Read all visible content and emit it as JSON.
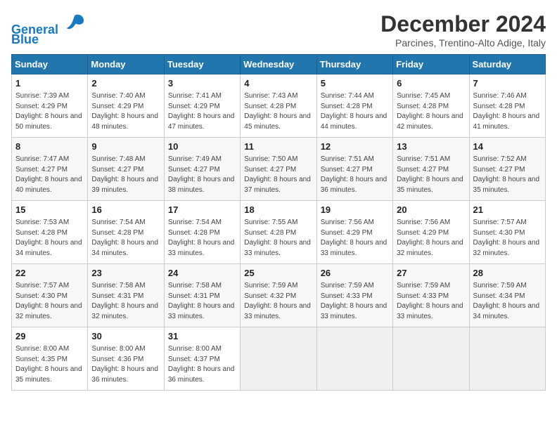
{
  "logo": {
    "line1": "General",
    "line2": "Blue"
  },
  "title": "December 2024",
  "subtitle": "Parcines, Trentino-Alto Adige, Italy",
  "weekdays": [
    "Sunday",
    "Monday",
    "Tuesday",
    "Wednesday",
    "Thursday",
    "Friday",
    "Saturday"
  ],
  "weeks": [
    [
      {
        "day": "1",
        "rise": "7:39 AM",
        "set": "4:29 PM",
        "daylight": "8 hours and 50 minutes."
      },
      {
        "day": "2",
        "rise": "7:40 AM",
        "set": "4:29 PM",
        "daylight": "8 hours and 48 minutes."
      },
      {
        "day": "3",
        "rise": "7:41 AM",
        "set": "4:29 PM",
        "daylight": "8 hours and 47 minutes."
      },
      {
        "day": "4",
        "rise": "7:43 AM",
        "set": "4:28 PM",
        "daylight": "8 hours and 45 minutes."
      },
      {
        "day": "5",
        "rise": "7:44 AM",
        "set": "4:28 PM",
        "daylight": "8 hours and 44 minutes."
      },
      {
        "day": "6",
        "rise": "7:45 AM",
        "set": "4:28 PM",
        "daylight": "8 hours and 42 minutes."
      },
      {
        "day": "7",
        "rise": "7:46 AM",
        "set": "4:28 PM",
        "daylight": "8 hours and 41 minutes."
      }
    ],
    [
      {
        "day": "8",
        "rise": "7:47 AM",
        "set": "4:27 PM",
        "daylight": "8 hours and 40 minutes."
      },
      {
        "day": "9",
        "rise": "7:48 AM",
        "set": "4:27 PM",
        "daylight": "8 hours and 39 minutes."
      },
      {
        "day": "10",
        "rise": "7:49 AM",
        "set": "4:27 PM",
        "daylight": "8 hours and 38 minutes."
      },
      {
        "day": "11",
        "rise": "7:50 AM",
        "set": "4:27 PM",
        "daylight": "8 hours and 37 minutes."
      },
      {
        "day": "12",
        "rise": "7:51 AM",
        "set": "4:27 PM",
        "daylight": "8 hours and 36 minutes."
      },
      {
        "day": "13",
        "rise": "7:51 AM",
        "set": "4:27 PM",
        "daylight": "8 hours and 35 minutes."
      },
      {
        "day": "14",
        "rise": "7:52 AM",
        "set": "4:27 PM",
        "daylight": "8 hours and 35 minutes."
      }
    ],
    [
      {
        "day": "15",
        "rise": "7:53 AM",
        "set": "4:28 PM",
        "daylight": "8 hours and 34 minutes."
      },
      {
        "day": "16",
        "rise": "7:54 AM",
        "set": "4:28 PM",
        "daylight": "8 hours and 34 minutes."
      },
      {
        "day": "17",
        "rise": "7:54 AM",
        "set": "4:28 PM",
        "daylight": "8 hours and 33 minutes."
      },
      {
        "day": "18",
        "rise": "7:55 AM",
        "set": "4:28 PM",
        "daylight": "8 hours and 33 minutes."
      },
      {
        "day": "19",
        "rise": "7:56 AM",
        "set": "4:29 PM",
        "daylight": "8 hours and 33 minutes."
      },
      {
        "day": "20",
        "rise": "7:56 AM",
        "set": "4:29 PM",
        "daylight": "8 hours and 32 minutes."
      },
      {
        "day": "21",
        "rise": "7:57 AM",
        "set": "4:30 PM",
        "daylight": "8 hours and 32 minutes."
      }
    ],
    [
      {
        "day": "22",
        "rise": "7:57 AM",
        "set": "4:30 PM",
        "daylight": "8 hours and 32 minutes."
      },
      {
        "day": "23",
        "rise": "7:58 AM",
        "set": "4:31 PM",
        "daylight": "8 hours and 32 minutes."
      },
      {
        "day": "24",
        "rise": "7:58 AM",
        "set": "4:31 PM",
        "daylight": "8 hours and 33 minutes."
      },
      {
        "day": "25",
        "rise": "7:59 AM",
        "set": "4:32 PM",
        "daylight": "8 hours and 33 minutes."
      },
      {
        "day": "26",
        "rise": "7:59 AM",
        "set": "4:33 PM",
        "daylight": "8 hours and 33 minutes."
      },
      {
        "day": "27",
        "rise": "7:59 AM",
        "set": "4:33 PM",
        "daylight": "8 hours and 33 minutes."
      },
      {
        "day": "28",
        "rise": "7:59 AM",
        "set": "4:34 PM",
        "daylight": "8 hours and 34 minutes."
      }
    ],
    [
      {
        "day": "29",
        "rise": "8:00 AM",
        "set": "4:35 PM",
        "daylight": "8 hours and 35 minutes."
      },
      {
        "day": "30",
        "rise": "8:00 AM",
        "set": "4:36 PM",
        "daylight": "8 hours and 36 minutes."
      },
      {
        "day": "31",
        "rise": "8:00 AM",
        "set": "4:37 PM",
        "daylight": "8 hours and 36 minutes."
      },
      null,
      null,
      null,
      null
    ]
  ]
}
